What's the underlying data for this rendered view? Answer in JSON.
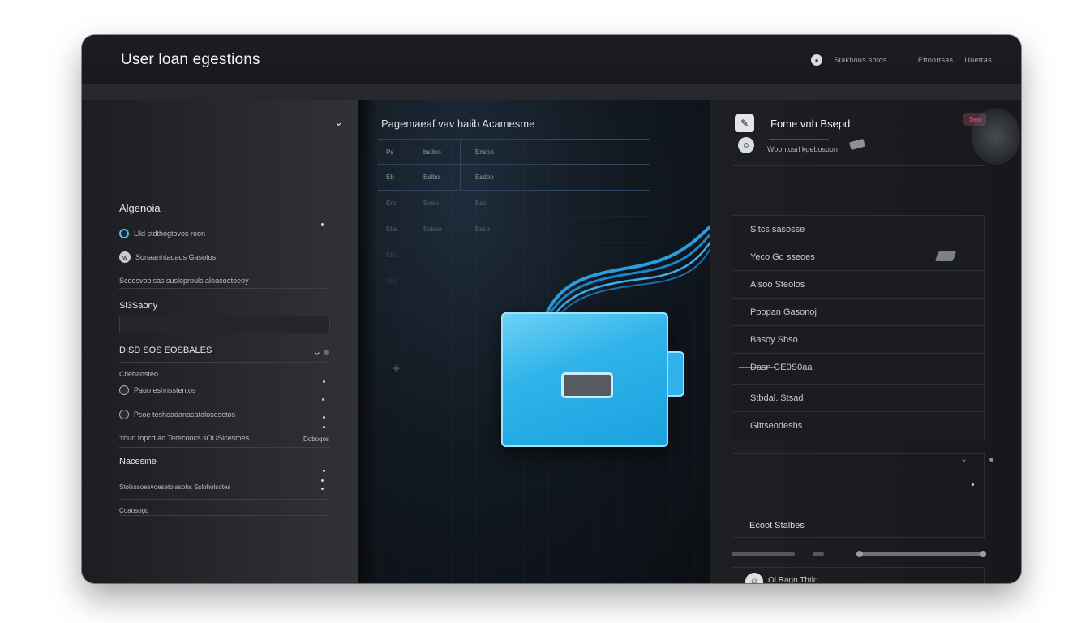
{
  "header": {
    "title": "User loan egestions",
    "user_label": "Stakhous sbtos",
    "links": [
      "Eftoortsas",
      "Uuetras"
    ]
  },
  "left_panel": {
    "section1_title": "Algenoia",
    "items": [
      {
        "label": "Llld stdthogtovos roon"
      },
      {
        "label": "Sonaanhtaoaos Gasotos"
      },
      {
        "label": "Scoosvoolsas susloprouls aloasoetoeoy"
      }
    ],
    "section2_title": "Sl3Saony",
    "section3_title": "DISD SOS EOSBALES",
    "sub_label": "Ctiehansteo",
    "items2": [
      {
        "label": "Pauo eshnsstentos"
      },
      {
        "label": "Psoe tesheadanasatalosesetos"
      },
      {
        "label": "Youn fopcd ad Tereconcs sOUSlcestoes"
      }
    ],
    "right_tag": "Doboqos",
    "section4_title": "Nacesine",
    "item4": "Stolsssoesvoesetolasohs Ssloholsotes",
    "item5": "Coaosogo"
  },
  "middle_panel": {
    "title": "Pagemaeaf vav haiib Acamesme",
    "table": {
      "rows": [
        [
          "Ps",
          "bsdoo",
          "Ensoo"
        ],
        [
          "Eb",
          "Eslbo",
          "Esdoo"
        ],
        [
          "Ero",
          "Eneo",
          "Eso"
        ],
        [
          "Ebs",
          "Esbao",
          "Esso"
        ],
        [
          "Ebo",
          "",
          ""
        ],
        [
          "Ebb",
          "",
          ""
        ]
      ]
    }
  },
  "right_panel": {
    "profile_name": "Fome vnh Bsepd",
    "profile_sub": "Woontosrl kgebosoon",
    "badge": "Seo",
    "settings": [
      "Sitcs sasosse",
      "Yeco Gd sseoes",
      "Alsoo Steolos",
      "Poopan Gasonoj",
      "Basoy Sbso",
      "Dasn GE0S0aa",
      "Stbdal. Stsad",
      "Gittseodeshs"
    ],
    "detail_label": "Ecoot Stalbes",
    "footer_text": "Ol Ragn Thtlo."
  },
  "colors": {
    "accent": "#2fb3ea",
    "window_bg": "#15171b",
    "badge": "#e36b83"
  },
  "icons": {
    "collapse": "chevron-down-icon",
    "folder": "folder-icon",
    "avatar": "avatar-icon"
  }
}
